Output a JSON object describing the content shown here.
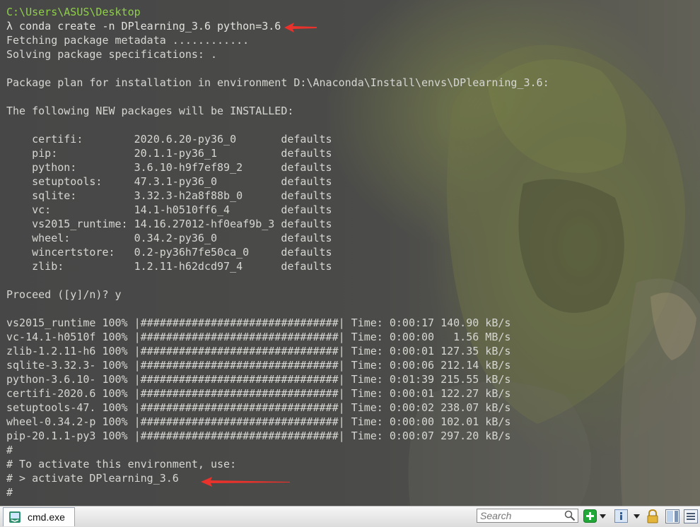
{
  "terminal": {
    "lines": [
      "C:\\Users\\ASUS\\Desktop",
      "λ conda create -n DPlearning_3.6 python=3.6",
      "Fetching package metadata ............",
      "Solving package specifications: .",
      "",
      "Package plan for installation in environment D:\\Anaconda\\Install\\envs\\DPlearning_3.6:",
      "",
      "The following NEW packages will be INSTALLED:",
      "",
      "    certifi:        2020.6.20-py36_0       defaults",
      "    pip:            20.1.1-py36_1          defaults",
      "    python:         3.6.10-h9f7ef89_2      defaults",
      "    setuptools:     47.3.1-py36_0          defaults",
      "    sqlite:         3.32.3-h2a8f88b_0      defaults",
      "    vc:             14.1-h0510ff6_4        defaults",
      "    vs2015_runtime: 14.16.27012-hf0eaf9b_3 defaults",
      "    wheel:          0.34.2-py36_0          defaults",
      "    wincertstore:   0.2-py36h7fe50ca_0     defaults",
      "    zlib:           1.2.11-h62dcd97_4      defaults",
      "",
      "Proceed ([y]/n)? y",
      "",
      "vs2015_runtime 100% |###############################| Time: 0:00:17 140.90 kB/s",
      "vc-14.1-h0510f 100% |###############################| Time: 0:00:00   1.56 MB/s",
      "zlib-1.2.11-h6 100% |###############################| Time: 0:00:01 127.35 kB/s",
      "sqlite-3.32.3- 100% |###############################| Time: 0:00:06 212.14 kB/s",
      "python-3.6.10- 100% |###############################| Time: 0:01:39 215.55 kB/s",
      "certifi-2020.6 100% |###############################| Time: 0:00:01 122.27 kB/s",
      "setuptools-47. 100% |###############################| Time: 0:00:02 238.07 kB/s",
      "wheel-0.34.2-p 100% |###############################| Time: 0:00:00 102.01 kB/s",
      "pip-20.1.1-py3 100% |###############################| Time: 0:00:07 297.20 kB/s",
      "#",
      "# To activate this environment, use:",
      "# > activate DPlearning_3.6",
      "#"
    ]
  },
  "taskbar": {
    "tab_label": "cmd.exe",
    "search_placeholder": "Search"
  },
  "colors": {
    "prompt_path": "#8fcf4a",
    "text": "#d6d6d2",
    "annotation_arrow": "#e8322b"
  },
  "icons": [
    "cmd-icon",
    "search-icon",
    "new-console-icon",
    "dropdown-icon",
    "info-icon",
    "lock-icon",
    "split-icon",
    "menu-icon"
  ]
}
